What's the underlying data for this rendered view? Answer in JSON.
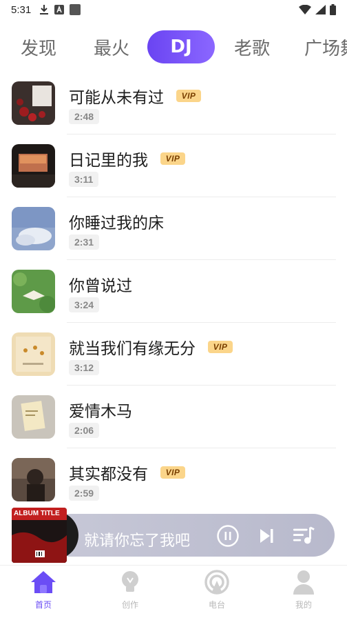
{
  "status_bar": {
    "time": "5:31",
    "left_icons": [
      "download-icon",
      "a-box-icon",
      "square-icon"
    ],
    "right_icons": [
      "wifi-icon",
      "signal-icon",
      "battery-icon"
    ]
  },
  "tabs": [
    {
      "label": "发现",
      "active": false
    },
    {
      "label": "最火",
      "active": false
    },
    {
      "label": "DJ",
      "active": true
    },
    {
      "label": "老歌",
      "active": false
    },
    {
      "label": "广场舞",
      "active": false
    }
  ],
  "vip_label": "VIP",
  "songs": [
    {
      "title": "可能从未有过",
      "duration": "2:48",
      "vip": true
    },
    {
      "title": "日记里的我",
      "duration": "3:11",
      "vip": true
    },
    {
      "title": "你睡过我的床",
      "duration": "2:31",
      "vip": false
    },
    {
      "title": "你曾说过",
      "duration": "3:24",
      "vip": false
    },
    {
      "title": "就当我们有缘无分",
      "duration": "3:12",
      "vip": true
    },
    {
      "title": "爱情木马",
      "duration": "2:06",
      "vip": false
    },
    {
      "title": "其实都没有",
      "duration": "2:59",
      "vip": true
    }
  ],
  "player": {
    "album_text": "ALBUM TITLE",
    "now_playing": "就请你忘了我吧",
    "icons": [
      "pause-icon",
      "next-icon",
      "playlist-icon"
    ]
  },
  "bottom_nav": [
    {
      "label": "首页",
      "icon": "home-icon",
      "active": true
    },
    {
      "label": "创作",
      "icon": "bulb-icon",
      "active": false
    },
    {
      "label": "电台",
      "icon": "radio-icon",
      "active": false
    },
    {
      "label": "我的",
      "icon": "user-icon",
      "active": false
    }
  ],
  "colors": {
    "accent": "#6b4df5",
    "vip_bg": "#fbd58a",
    "player_bg": "#c2c3d4"
  }
}
